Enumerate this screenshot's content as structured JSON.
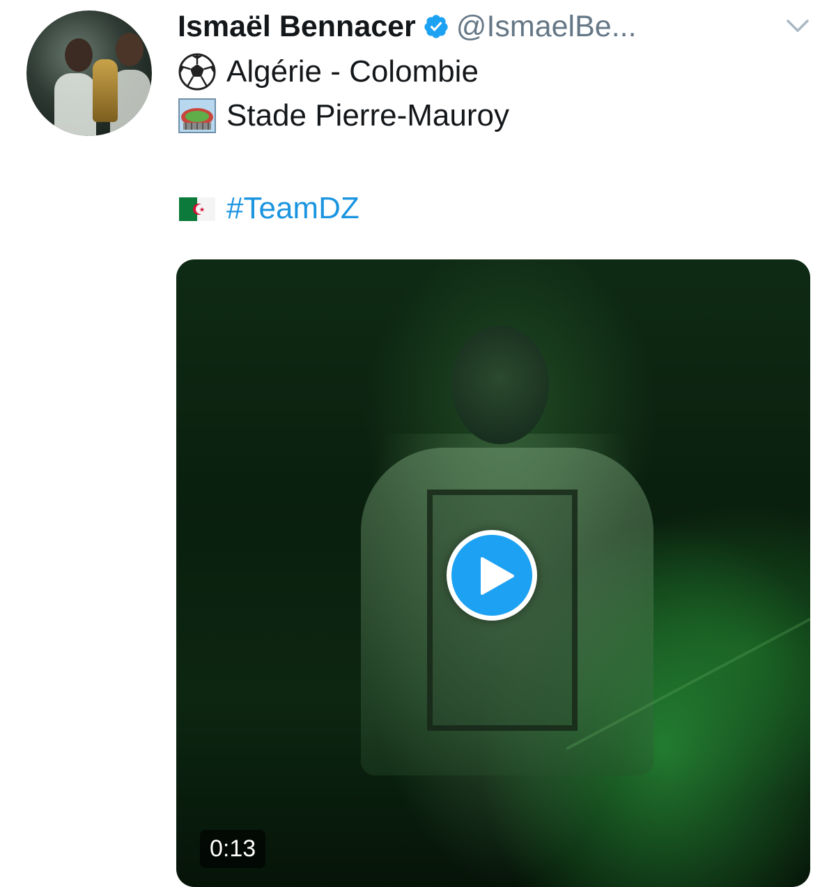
{
  "tweet": {
    "author_name": "Ismaël Bennacer",
    "author_handle": "@IsmaelBe...",
    "lines": [
      {
        "emoji": "soccer-ball-icon",
        "text": "Algérie - Colombie"
      },
      {
        "emoji": "stadium-icon",
        "text": "Stade Pierre-Mauroy"
      }
    ],
    "hashtag_line": {
      "emoji": "algeria-flag-icon",
      "text": "#TeamDZ"
    }
  },
  "video": {
    "duration": "0:13"
  },
  "colors": {
    "accent": "#1da1f2",
    "hashtag": "#1b95e0",
    "handle": "#657786"
  },
  "icons": {
    "verified": "verified-badge-icon",
    "menu": "chevron-down-icon",
    "play": "play-icon"
  }
}
